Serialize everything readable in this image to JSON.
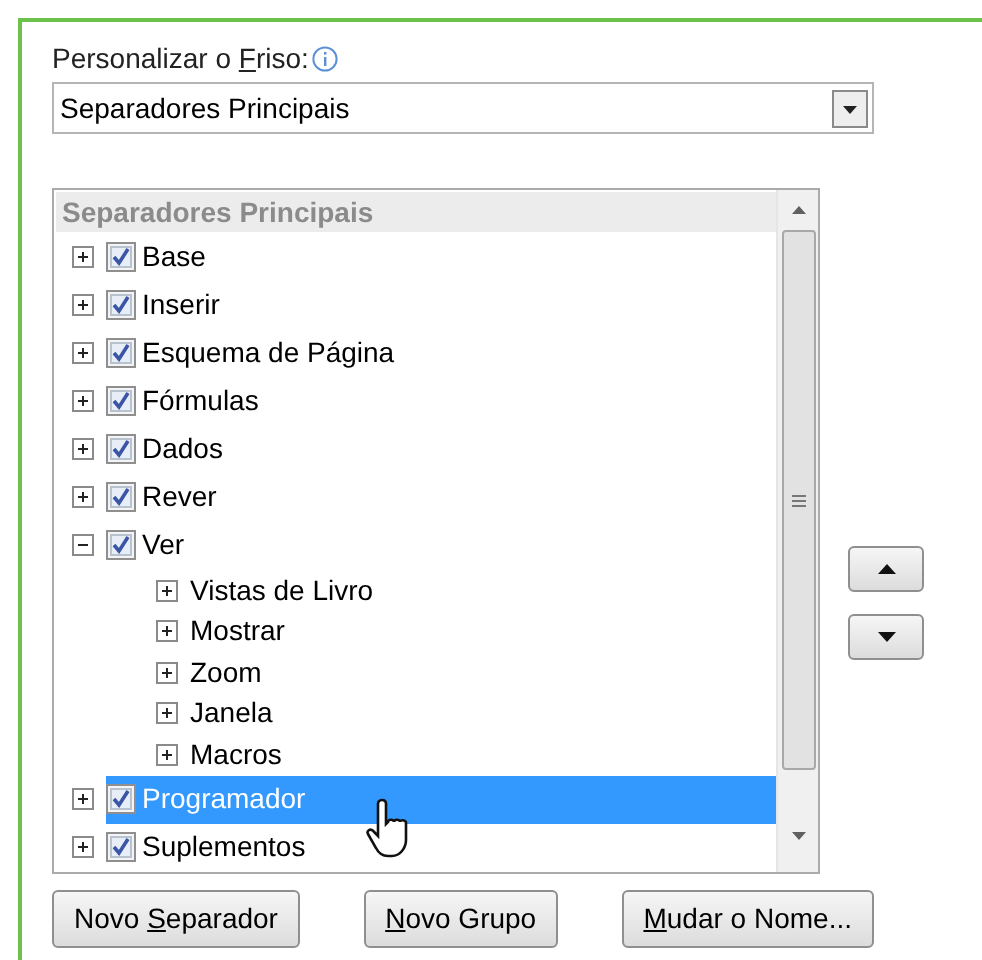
{
  "customize_label": {
    "before": "Personalizar o ",
    "key": "F",
    "after": "riso:"
  },
  "ribbon_dropdown": {
    "value": "Separadores Principais"
  },
  "tree": {
    "header": "Separadores Principais",
    "items": [
      {
        "kind": "tab",
        "label": "Base",
        "checked": true,
        "expanded": false,
        "selected": false
      },
      {
        "kind": "tab",
        "label": "Inserir",
        "checked": true,
        "expanded": false,
        "selected": false
      },
      {
        "kind": "tab",
        "label": "Esquema de Página",
        "checked": true,
        "expanded": false,
        "selected": false
      },
      {
        "kind": "tab",
        "label": "Fórmulas",
        "checked": true,
        "expanded": false,
        "selected": false
      },
      {
        "kind": "tab",
        "label": "Dados",
        "checked": true,
        "expanded": false,
        "selected": false
      },
      {
        "kind": "tab",
        "label": "Rever",
        "checked": true,
        "expanded": false,
        "selected": false
      },
      {
        "kind": "tab",
        "label": "Ver",
        "checked": true,
        "expanded": true,
        "selected": false,
        "children": [
          {
            "kind": "group",
            "label": "Vistas de Livro",
            "expanded": false,
            "selected": false
          },
          {
            "kind": "group",
            "label": "Mostrar",
            "expanded": false,
            "selected": false
          },
          {
            "kind": "group",
            "label": "Zoom",
            "expanded": false,
            "selected": false
          },
          {
            "kind": "group",
            "label": "Janela",
            "expanded": false,
            "selected": false
          },
          {
            "kind": "group",
            "label": "Macros",
            "expanded": false,
            "selected": false
          }
        ]
      },
      {
        "kind": "tab",
        "label": "Programador",
        "checked": true,
        "expanded": false,
        "selected": true
      },
      {
        "kind": "tab",
        "label": "Suplementos",
        "checked": true,
        "expanded": false,
        "selected": false
      }
    ]
  },
  "buttons": [
    {
      "before": "Novo ",
      "key": "S",
      "after": "eparador"
    },
    {
      "key": "N",
      "after": "ovo Grupo"
    },
    {
      "key": "M",
      "after": "udar o Nome..."
    }
  ]
}
